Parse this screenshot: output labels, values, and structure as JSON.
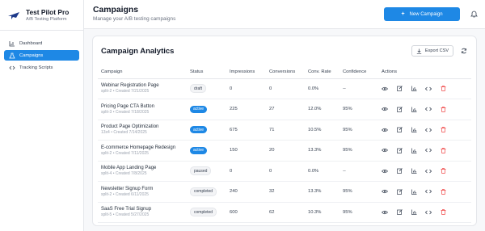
{
  "brand": {
    "title": "Test Pilot Pro",
    "subtitle": "A/B Testing Platform"
  },
  "sidebar": {
    "items": [
      {
        "label": "Dashboard",
        "icon": "chart-icon",
        "active": false
      },
      {
        "label": "Campaigns",
        "icon": "flask-icon",
        "active": true
      },
      {
        "label": "Tracking Scripts",
        "icon": "code-icon",
        "active": false
      }
    ]
  },
  "header": {
    "title": "Campaigns",
    "subtitle": "Manage your A/B testing campaigns",
    "new_button": "New Campaign"
  },
  "card": {
    "title": "Campaign Analytics",
    "export_label": "Export CSV"
  },
  "table": {
    "columns": [
      "Campaign",
      "Status",
      "Impressions",
      "Conversions",
      "Conv. Rate",
      "Confidence",
      "Actions"
    ],
    "rows": [
      {
        "name": "Webinar Registration Page",
        "meta": "split-2 • Created 7/21/2025",
        "status": "draft",
        "impressions": "0",
        "conversions": "0",
        "rate": "0.0%",
        "confidence": "--"
      },
      {
        "name": "Pricing Page CTA Button",
        "meta": "split-3 • Created 7/18/2025",
        "status": "active",
        "impressions": "225",
        "conversions": "27",
        "rate": "12.0%",
        "confidence": "95%"
      },
      {
        "name": "Product Page Optimization",
        "meta": "13x4 • Created 7/14/2025",
        "status": "active",
        "impressions": "675",
        "conversions": "71",
        "rate": "10.5%",
        "confidence": "95%"
      },
      {
        "name": "E-commerce Homepage Redesign",
        "meta": "split-2 • Created 7/11/2025",
        "status": "active",
        "impressions": "150",
        "conversions": "20",
        "rate": "13.3%",
        "confidence": "95%"
      },
      {
        "name": "Mobile App Landing Page",
        "meta": "split-4 • Created 7/8/2025",
        "status": "paused",
        "impressions": "0",
        "conversions": "0",
        "rate": "0.0%",
        "confidence": "--"
      },
      {
        "name": "Newsletter Signup Form",
        "meta": "split-2 • Created 6/11/2025",
        "status": "completed",
        "impressions": "240",
        "conversions": "32",
        "rate": "13.3%",
        "confidence": "95%"
      },
      {
        "name": "SaaS Free Trial Signup",
        "meta": "split-5 • Created 5/27/2025",
        "status": "completed",
        "impressions": "600",
        "conversions": "62",
        "rate": "10.3%",
        "confidence": "95%"
      }
    ]
  },
  "colors": {
    "accent": "#1e88e5",
    "delete": "#ef4444"
  }
}
